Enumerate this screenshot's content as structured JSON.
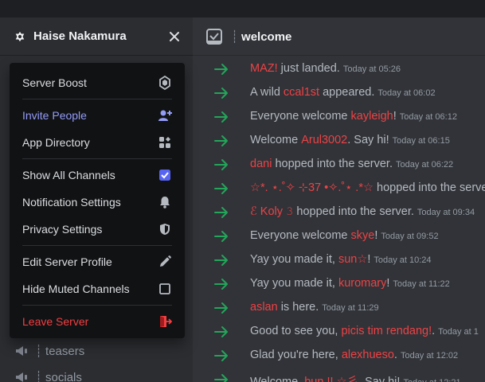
{
  "server": {
    "name": "Haise Nakamura"
  },
  "channel": {
    "name": "welcome",
    "prefix": "┊"
  },
  "sidebar_channels": [
    {
      "prefix": "┊",
      "name": "teasers"
    },
    {
      "prefix": "┊",
      "name": "socials"
    }
  ],
  "menu": {
    "server_boost": "Server Boost",
    "invite_people": "Invite People",
    "app_directory": "App Directory",
    "show_all_channels": "Show All Channels",
    "notification_settings": "Notification Settings",
    "privacy_settings": "Privacy Settings",
    "edit_server_profile": "Edit Server Profile",
    "hide_muted_channels": "Hide Muted Channels",
    "leave_server": "Leave Server"
  },
  "messages": [
    {
      "pre": "",
      "user": "MAZ!",
      "post": " just landed.",
      "ts": "Today at 05:26"
    },
    {
      "pre": "A wild ",
      "user": "ccal1st",
      "post": " appeared.",
      "ts": "Today at 06:02"
    },
    {
      "pre": "Everyone welcome ",
      "user": "kayleigh",
      "post": "!",
      "ts": "Today at 06:12"
    },
    {
      "pre": "Welcome ",
      "user": "Arul3002",
      "post": ". Say hi!",
      "ts": "Today at 06:15"
    },
    {
      "pre": "",
      "user": "dani",
      "post": " hopped into the server.",
      "ts": "Today at 06:22"
    },
    {
      "pre": "",
      "user": "☆*. ⋆.˚✧ ⊹37 •✧.˚⋆ .*☆",
      "post": " hopped into the server.",
      "ts": ""
    },
    {
      "pre": "",
      "user": "ℰ Koly 𝟹",
      "post": " hopped into the server.",
      "ts": "Today at 09:34"
    },
    {
      "pre": "Everyone welcome ",
      "user": "skye",
      "post": "!",
      "ts": "Today at 09:52"
    },
    {
      "pre": "Yay you made it, ",
      "user": "sun☆",
      "post": "!",
      "ts": "Today at 10:24"
    },
    {
      "pre": "Yay you made it, ",
      "user": "kuromary",
      "post": "!",
      "ts": "Today at 11:22"
    },
    {
      "pre": "",
      "user": "aslan",
      "post": " is here.",
      "ts": "Today at 11:29"
    },
    {
      "pre": "Good to see you, ",
      "user": "picis tim rendang!",
      "post": ".",
      "ts": "Today at 1"
    },
    {
      "pre": "Glad you're here, ",
      "user": "alexhueso",
      "post": ".",
      "ts": "Today at 12:02"
    },
    {
      "pre": "Welcome, ",
      "user": "bun !! ☆彡",
      "post": ". Say hi!",
      "ts": "Today at 12:21"
    }
  ],
  "colors": {
    "accent": "#949cf7",
    "danger": "#f23f42",
    "join_arrow": "#23a55a",
    "username": "#ed4245"
  }
}
